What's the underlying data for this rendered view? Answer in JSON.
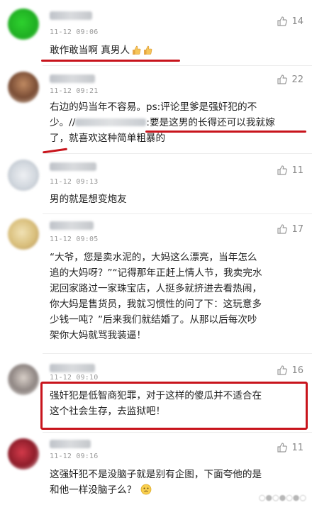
{
  "comments": [
    {
      "time": "11-12 09:06",
      "likes": "14",
      "lines": [
        "敢作敢当啊 真男人"
      ]
    },
    {
      "time": "11-12 09:21",
      "likes": "22",
      "line1": "右边的妈当年不容易。ps:评论里爹是强奸犯的不",
      "line2_pre": "少。//",
      "line2_post": ":要是这男的长得还可以我就嫁",
      "line3": "了，就喜欢这种简单粗暴的"
    },
    {
      "time": "11-12 09:13",
      "likes": "11",
      "lines": [
        "男的就是想变炮友"
      ]
    },
    {
      "time": "11-12 09:05",
      "likes": "17",
      "lines": [
        "“大爷，您是卖水泥的，大妈这么漂亮，当年怎么",
        "追的大妈呀？”“记得那年正赶上情人节，我卖完水",
        "泥回家路过一家珠宝店，人挺多就挤进去看热闹，",
        "你大妈是售货员，我就习惯性的问了下：这玩意多",
        "少钱一吨？”后来我们就结婚了。从那以后每次吵",
        "架你大妈就骂我装逼！"
      ]
    },
    {
      "time": "11-12 09:10",
      "likes": "16",
      "lines": [
        "强奸犯是低智商犯罪，对于这样的傻瓜并不适合在",
        "这个社会生存，去监狱吧！"
      ]
    },
    {
      "time": "11-12 09:16",
      "likes": "11",
      "lines": [
        "这强奸犯不是没脑子就是别有企图，下面夸他的是",
        "和他一样没脑子么？"
      ]
    }
  ],
  "colors": {
    "highlight": "#c8141c",
    "time": "#9a9a9a",
    "text": "#222222"
  },
  "icons": {
    "like": "thumbs-up-icon",
    "thumb_emoji": "thumbs-up-emoji",
    "think_emoji": "thinking-face-emoji"
  }
}
